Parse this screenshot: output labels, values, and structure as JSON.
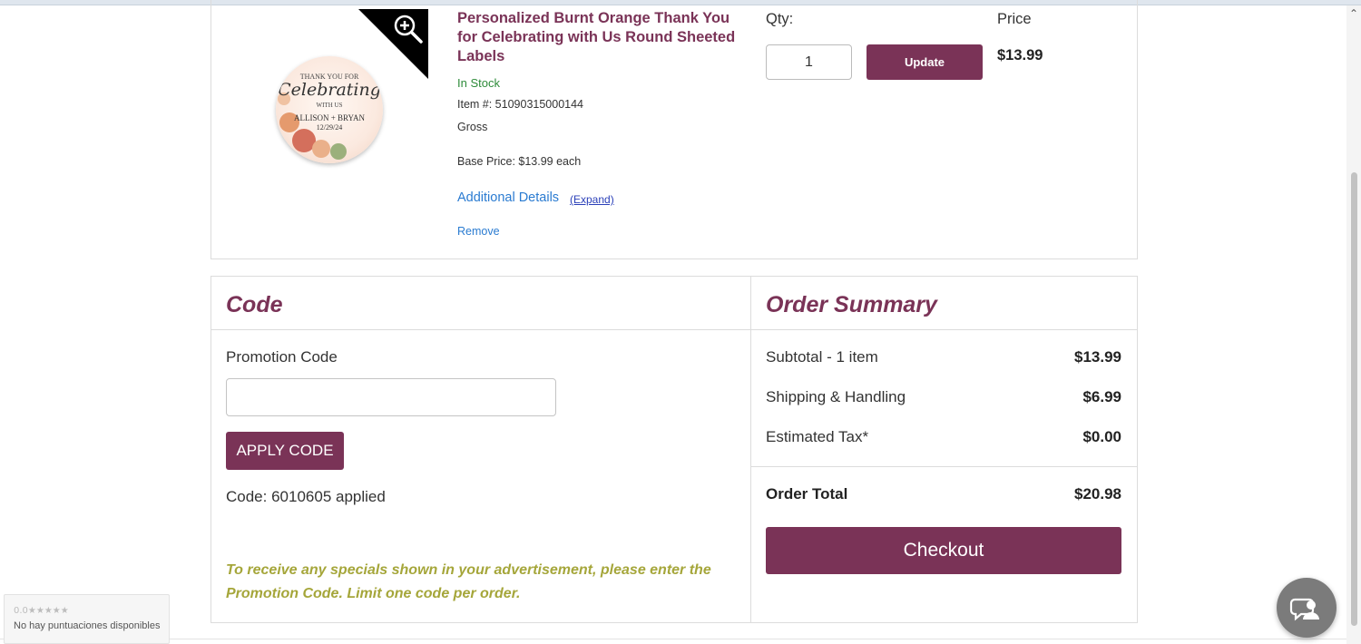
{
  "product": {
    "title": "Personalized Burnt Orange Thank You for Celebrating with Us Round Sheeted Labels",
    "stock_status": "In Stock",
    "item_number": "Item #: 51090315000144",
    "unit": "Gross",
    "base_price": "Base Price: $13.99 each",
    "additional_details_label": "Additional Details",
    "expand_label": "(Expand)",
    "remove_label": "Remove",
    "image_text": {
      "line1": "THANK YOU FOR",
      "line2": "Celebrating",
      "line3": "WITH US",
      "line4": "ALLISON + BRYAN",
      "line5": "12/29/24"
    },
    "zoom_icon": "zoom-in-icon"
  },
  "quantity": {
    "label": "Qty:",
    "value": "1",
    "update_label": "Update"
  },
  "price": {
    "label": "Price",
    "value": "$13.99"
  },
  "code_panel": {
    "heading": "Code",
    "promo_label": "Promotion Code",
    "promo_value": "",
    "apply_label": "APPLY CODE",
    "applied_text": "Code: 6010605 applied",
    "note": "To receive any specials shown in your advertisement, please enter the Promotion Code. Limit one code per order."
  },
  "order_summary": {
    "heading": "Order Summary",
    "rows": [
      {
        "label": "Subtotal - 1 item",
        "value": "$13.99"
      },
      {
        "label": "Shipping & Handling",
        "value": "$6.99"
      },
      {
        "label": "Estimated Tax*",
        "value": "$0.00"
      }
    ],
    "total_label": "Order Total",
    "total_value": "$20.98",
    "checkout_label": "Checkout"
  },
  "rating_widget": {
    "score": "0.0",
    "stars": "★★★★★",
    "text": "No hay puntuaciones disponibles"
  },
  "chat": {
    "icon": "chat-support-icon"
  },
  "colors": {
    "brand": "#7a3357",
    "in_stock": "#2e8b3a",
    "link": "#2a7bd1",
    "promo_note": "#a5a63a"
  }
}
